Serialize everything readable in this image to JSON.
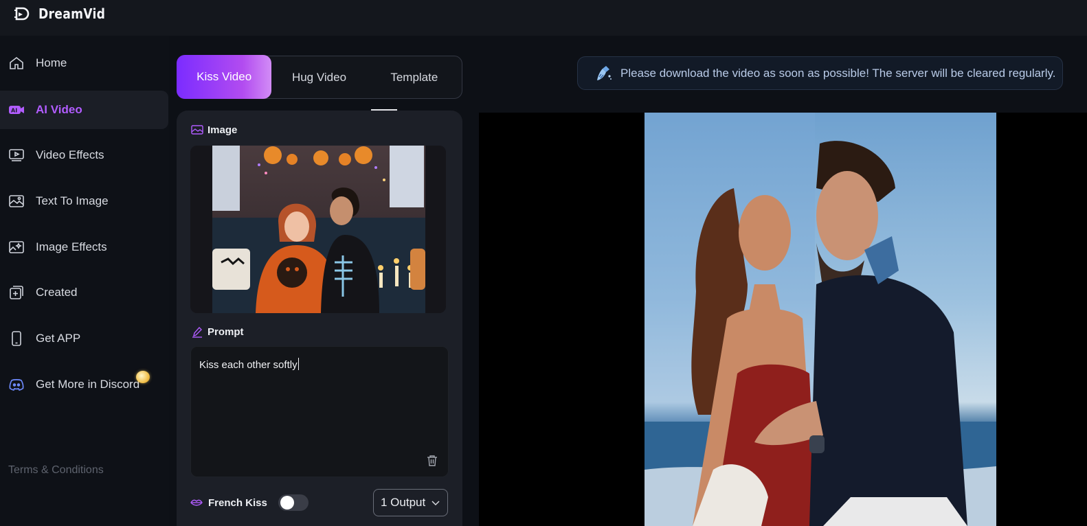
{
  "app": {
    "name": "DreamVid"
  },
  "sidebar": {
    "items": [
      {
        "label": "Home",
        "icon": "home-icon"
      },
      {
        "label": "AI Video",
        "icon": "ai-video-icon",
        "active": true
      },
      {
        "label": "Video Effects",
        "icon": "video-effects-icon"
      },
      {
        "label": "Text To Image",
        "icon": "text-to-image-icon"
      },
      {
        "label": "Image Effects",
        "icon": "image-effects-icon"
      },
      {
        "label": "Created",
        "icon": "created-icon"
      },
      {
        "label": "Get APP",
        "icon": "phone-icon"
      },
      {
        "label": "Get More in Discord",
        "icon": "discord-icon"
      }
    ],
    "footer": {
      "terms": "Terms & Conditions"
    }
  },
  "tabs": [
    {
      "label": "Kiss Video",
      "active": true
    },
    {
      "label": "Hug Video"
    },
    {
      "label": "Template"
    }
  ],
  "panel": {
    "image_label": "Image",
    "prompt_label": "Prompt",
    "prompt_value": "Kiss each other softly",
    "french_kiss_label": "French Kiss",
    "french_kiss_on": false,
    "output_value": "1 Output"
  },
  "notice": {
    "text": "Please download the video as soon as possible! The server will be cleared regularly."
  },
  "colors": {
    "accent": "#b15cff",
    "tab_gradient_start": "#7b2cff",
    "tab_gradient_end": "#d28cf6"
  }
}
